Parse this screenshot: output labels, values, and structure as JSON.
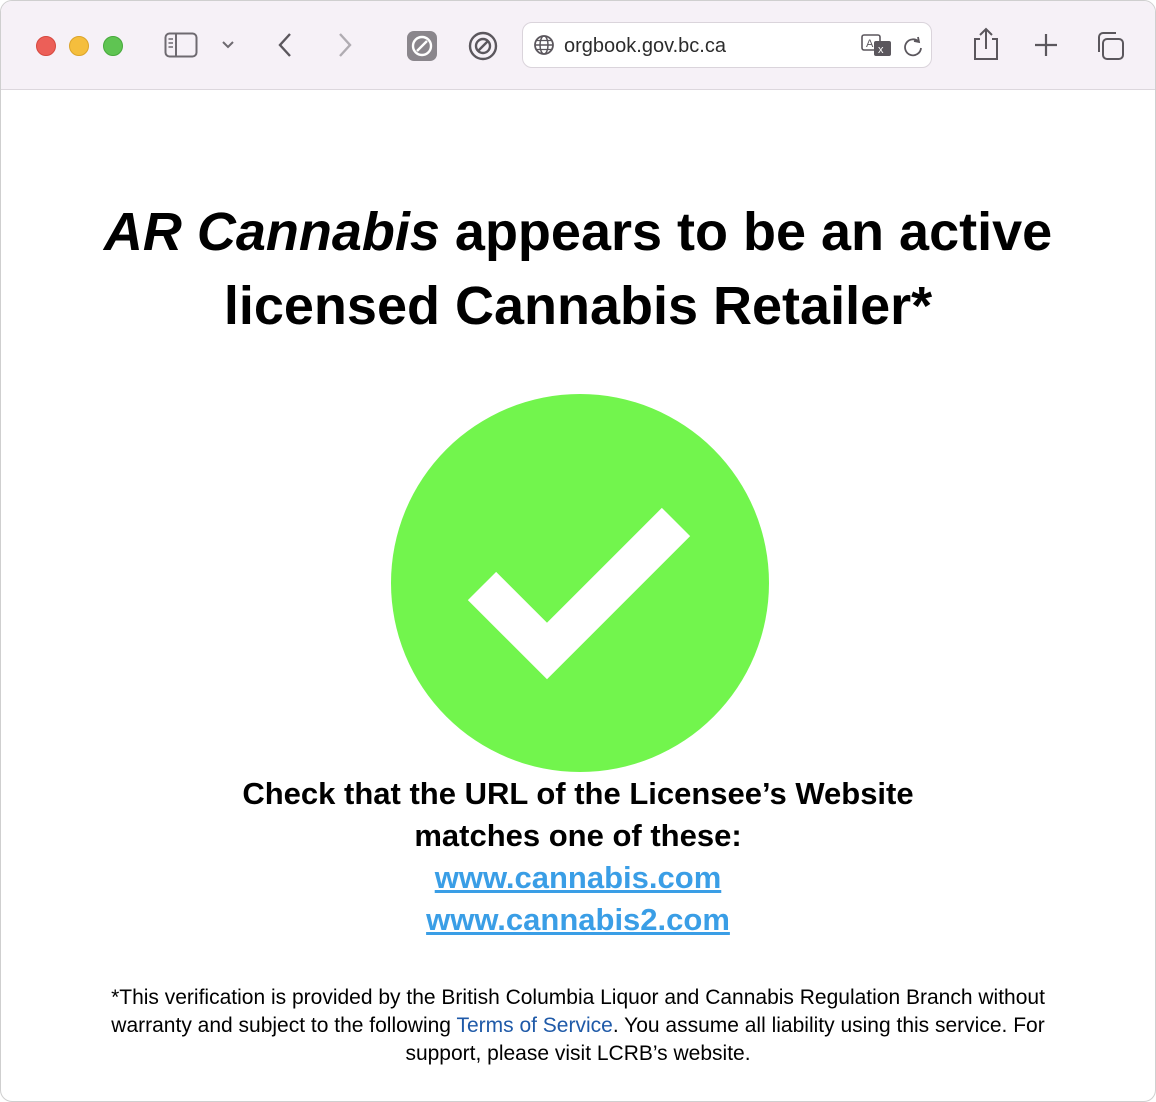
{
  "browser": {
    "url": "orgbook.gov.bc.ca"
  },
  "headline": {
    "name": "AR Cannabis",
    "rest": " appears to be an active licensed Cannabis Retailer*"
  },
  "check_instruction": "Check that the URL of the Licensee’s Website matches one of these:",
  "links": [
    "www.cannabis.com",
    "www.cannabis2.com"
  ],
  "footer": {
    "before": "*This verification is provided by the British Columbia Liquor and Cannabis Regulation Branch without warranty and subject to the following ",
    "tos": "Terms of Service",
    "after": ". You assume all liability using this service. For support, please visit LCRB’s website."
  },
  "colors": {
    "check_circle": "#72f54d",
    "link": "#3a9ee6",
    "tos_link": "#1f5aa8"
  }
}
